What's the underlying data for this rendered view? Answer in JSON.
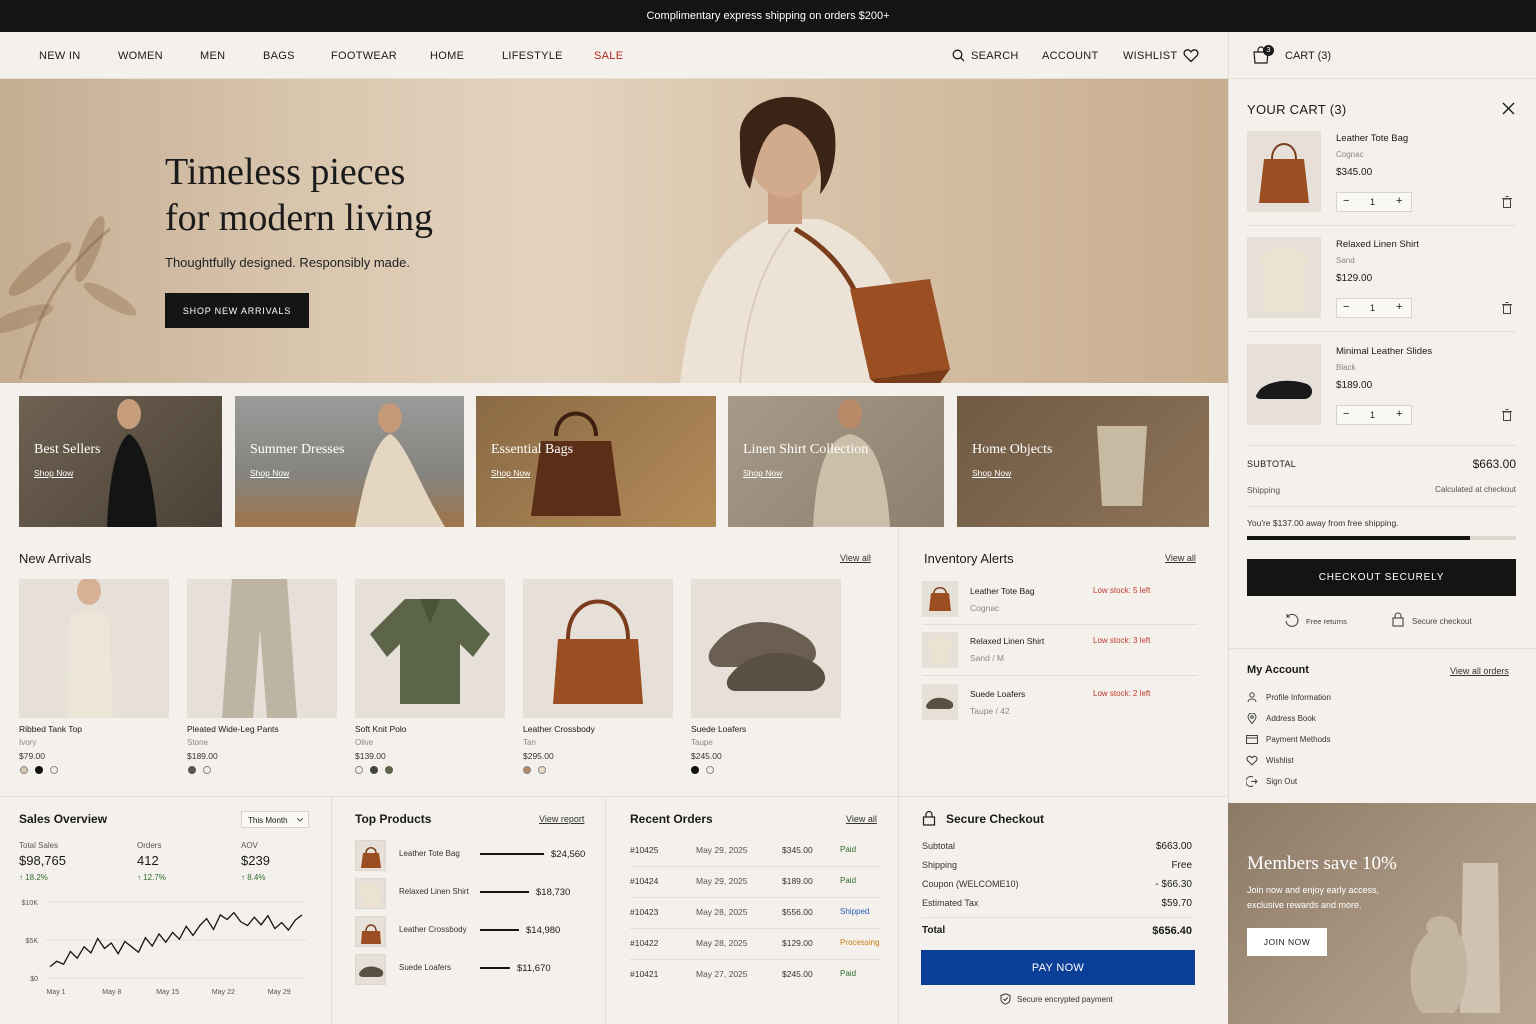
{
  "promo": {
    "text": "Complimentary express shipping on orders $200+"
  },
  "nav": {
    "items": [
      "NEW IN",
      "WOMEN",
      "MEN",
      "BAGS",
      "FOOTWEAR",
      "HOME",
      "LIFESTYLE",
      "SALE"
    ],
    "search": "SEARCH",
    "account": "ACCOUNT",
    "wishlist": "WISHLIST",
    "cart": "CART (3)",
    "cart_count": "3"
  },
  "hero": {
    "title_line1": "Timeless pieces",
    "title_line2": "for modern living",
    "subtitle": "Thoughtfully designed. Responsibly made.",
    "cta": "SHOP NEW ARRIVALS"
  },
  "categories": [
    {
      "title": "Best Sellers",
      "link": "Shop Now"
    },
    {
      "title": "Summer Dresses",
      "link": "Shop Now"
    },
    {
      "title": "Essential Bags",
      "link": "Shop Now"
    },
    {
      "title": "Linen Shirt Collection",
      "link": "Shop Now"
    },
    {
      "title": "Home Objects",
      "link": "Shop Now"
    }
  ],
  "new_arrivals": {
    "title": "New Arrivals",
    "view_all": "View all",
    "products": [
      {
        "name": "Ribbed Tank Top",
        "color": "Ivory",
        "price": "$79.00"
      },
      {
        "name": "Pleated Wide-Leg Pants",
        "color": "Stone",
        "price": "$189.00"
      },
      {
        "name": "Soft Knit Polo",
        "color": "Olive",
        "price": "$139.00"
      },
      {
        "name": "Leather Crossbody",
        "color": "Tan",
        "price": "$295.00"
      },
      {
        "name": "Suede Loafers",
        "color": "Taupe",
        "price": "$245.00"
      }
    ]
  },
  "inventory": {
    "title": "Inventory Alerts",
    "view_all": "View all",
    "items": [
      {
        "name": "Leather Tote Bag",
        "variant": "Cognac",
        "alert": "Low stock: 5 left"
      },
      {
        "name": "Relaxed Linen Shirt",
        "variant": "Sand / M",
        "alert": "Low stock: 3 left"
      },
      {
        "name": "Suede Loafers",
        "variant": "Taupe / 42",
        "alert": "Low stock: 2 left"
      }
    ]
  },
  "cart": {
    "title": "YOUR CART (3)",
    "items": [
      {
        "name": "Leather Tote Bag",
        "variant": "Cognac",
        "price": "$345.00",
        "qty": "1"
      },
      {
        "name": "Relaxed Linen Shirt",
        "variant": "Sand",
        "price": "$129.00",
        "qty": "1"
      },
      {
        "name": "Minimal Leather Slides",
        "variant": "Black",
        "price": "$189.00",
        "qty": "1"
      }
    ],
    "subtotal_label": "SUBTOTAL",
    "subtotal": "$663.00",
    "shipping_label": "Shipping",
    "shipping": "Calculated at checkout",
    "free_ship_msg": "You're $137.00 away from free shipping.",
    "free_ship_progress": 0.83,
    "checkout": "CHECKOUT SECURELY",
    "free_returns": "Free returns",
    "secure_checkout": "Secure checkout"
  },
  "account": {
    "title": "My Account",
    "view_orders": "View all orders",
    "items": [
      "Profile Information",
      "Address Book",
      "Payment Methods",
      "Wishlist",
      "Sign Out"
    ]
  },
  "sales": {
    "title": "Sales Overview",
    "period": "This Month",
    "kpis": [
      {
        "label": "Total Sales",
        "value": "$98,765",
        "change": "↑ 18.2%"
      },
      {
        "label": "Orders",
        "value": "412",
        "change": "↑ 12.7%"
      },
      {
        "label": "AOV",
        "value": "$239",
        "change": "↑ 8.4%"
      }
    ]
  },
  "chart_data": {
    "type": "line",
    "x": [
      "May 1",
      "May 8",
      "May 15",
      "May 22",
      "May 29"
    ],
    "yticks": [
      "$10K",
      "$5K",
      "$0"
    ],
    "ylim": [
      0,
      10000
    ],
    "values": [
      1500,
      2200,
      1800,
      3500,
      2600,
      4100,
      3300,
      5200,
      3900,
      4600,
      3200,
      4800,
      4100,
      3400,
      5300,
      4200,
      5800,
      4700,
      6000,
      5100,
      6800,
      5600,
      6900,
      7800,
      6400,
      8300,
      7700,
      8600,
      7400,
      6900,
      8000,
      7000,
      8200,
      6500,
      7300,
      6300,
      7600,
      8300
    ]
  },
  "top_products": {
    "title": "Top Products",
    "view": "View report",
    "max": 24560,
    "items": [
      {
        "name": "Leather Tote Bag",
        "value": "$24,560",
        "num": 24560
      },
      {
        "name": "Relaxed Linen Shirt",
        "value": "$18,730",
        "num": 18730
      },
      {
        "name": "Leather Crossbody",
        "value": "$14,980",
        "num": 14980
      },
      {
        "name": "Suede Loafers",
        "value": "$11,670",
        "num": 11670
      }
    ]
  },
  "orders": {
    "title": "Recent Orders",
    "view_all": "View all",
    "rows": [
      {
        "id": "#10425",
        "date": "May 29, 2025",
        "amount": "$345.00",
        "status": "Paid"
      },
      {
        "id": "#10424",
        "date": "May 29, 2025",
        "amount": "$189.00",
        "status": "Paid"
      },
      {
        "id": "#10423",
        "date": "May 28, 2025",
        "amount": "$556.00",
        "status": "Shipped"
      },
      {
        "id": "#10422",
        "date": "May 28, 2025",
        "amount": "$129.00",
        "status": "Processing"
      },
      {
        "id": "#10421",
        "date": "May 27, 2025",
        "amount": "$245.00",
        "status": "Paid"
      }
    ]
  },
  "secure": {
    "title": "Secure Checkout",
    "rows": [
      {
        "label": "Subtotal",
        "value": "$663.00"
      },
      {
        "label": "Shipping",
        "value": "Free"
      },
      {
        "label": "Coupon (WELCOME10)",
        "value": "- $66.30"
      },
      {
        "label": "Estimated Tax",
        "value": "$59.70"
      }
    ],
    "total_label": "Total",
    "total": "$656.40",
    "pay": "PAY NOW",
    "note": "Secure encrypted payment"
  },
  "members": {
    "title": "Members save 10%",
    "line1": "Join now and enjoy early access,",
    "line2": "exclusive rewards and more.",
    "cta": "JOIN NOW"
  },
  "colors": {
    "sale": "#b3261e",
    "pay": "#0b3e96",
    "paid": "#2f6b2f",
    "shipped": "#2a5db0",
    "processing": "#c77a12",
    "alert": "#c0392b"
  }
}
